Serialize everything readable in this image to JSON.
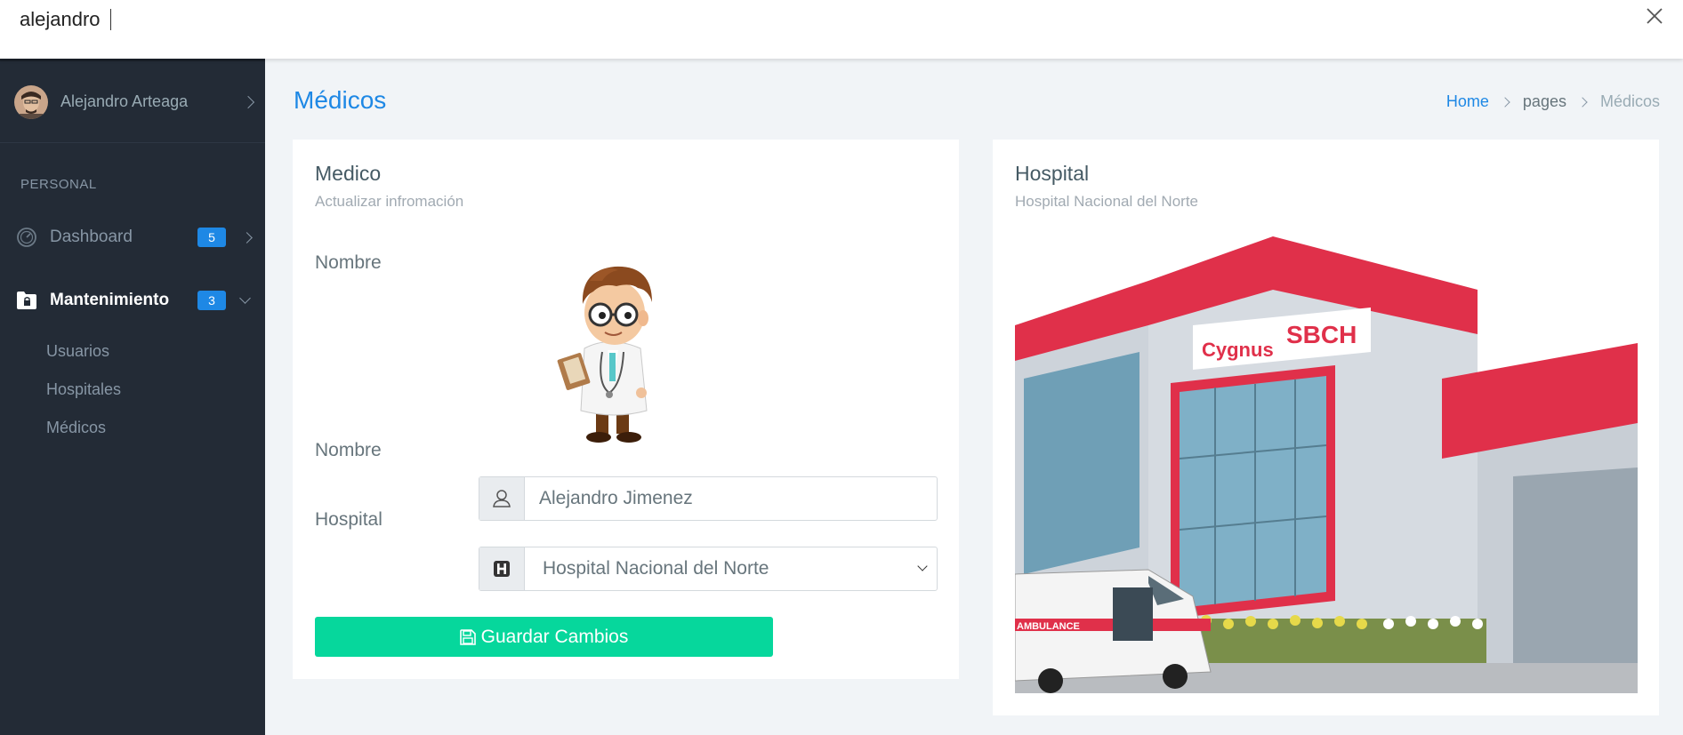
{
  "search": {
    "value": "alejandro",
    "placeholder": ""
  },
  "sidebar": {
    "user": {
      "name": "Alejandro Arteaga"
    },
    "section_label": "PERSONAL",
    "items": [
      {
        "label": "Dashboard",
        "badge": "5"
      },
      {
        "label": "Mantenimiento",
        "badge": "3"
      }
    ],
    "sub_items": [
      {
        "label": "Usuarios"
      },
      {
        "label": "Hospitales"
      },
      {
        "label": "Médicos"
      }
    ]
  },
  "page": {
    "title": "Médicos",
    "breadcrumb": [
      "Home",
      "pages",
      "Médicos"
    ]
  },
  "medico_card": {
    "title": "Medico",
    "subtitle": "Actualizar infromación",
    "image_label": "Nombre",
    "name_label": "Nombre",
    "name_value": "Alejandro Jimenez",
    "hospital_label": "Hospital",
    "hospital_selected": "Hospital Nacional del Norte",
    "save_label": "Guardar Cambios"
  },
  "hospital_card": {
    "title": "Hospital",
    "subtitle": "Hospital Nacional del Norte",
    "sign_left": "Cygnus",
    "sign_right": "SBCH",
    "ambulance_text": "AMBULANCE"
  },
  "colors": {
    "sidebar_bg": "#232b36",
    "accent_blue": "#1e88e5",
    "save_green": "#06d79c",
    "hospital_red": "#e0304a"
  },
  "icons": [
    "close-icon",
    "user-avatar",
    "dashboard-icon",
    "folder-lock-icon",
    "user-icon",
    "hospital-h-icon",
    "save-icon",
    "chevron-right-icon",
    "chevron-down-icon"
  ]
}
